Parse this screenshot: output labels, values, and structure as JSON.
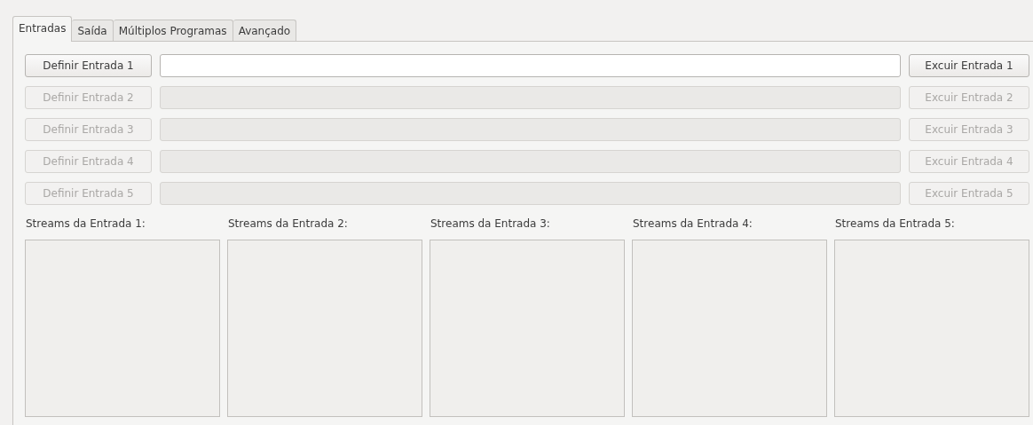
{
  "tabs": [
    {
      "label": "Entradas",
      "selected": true
    },
    {
      "label": "Saída",
      "selected": false
    },
    {
      "label": "Múltiplos Programas",
      "selected": false
    },
    {
      "label": "Avançado",
      "selected": false
    }
  ],
  "inputs": [
    {
      "define_button": "Definir Entrada 1",
      "remove_button": "Excuir Entrada 1",
      "disabled": false
    },
    {
      "define_button": "Definir Entrada 2",
      "remove_button": "Excuir Entrada 2",
      "disabled": true
    },
    {
      "define_button": "Definir Entrada 3",
      "remove_button": "Excuir Entrada 3",
      "disabled": true
    },
    {
      "define_button": "Definir Entrada 4",
      "remove_button": "Excuir Entrada 4",
      "disabled": true
    },
    {
      "define_button": "Definir Entrada 5",
      "remove_button": "Excuir Entrada 5",
      "disabled": true
    }
  ],
  "streams": [
    {
      "label": "Streams da Entrada 1:"
    },
    {
      "label": "Streams da Entrada 2:"
    },
    {
      "label": "Streams da Entrada 3:"
    },
    {
      "label": "Streams da Entrada 4:"
    },
    {
      "label": "Streams da Entrada 5:"
    }
  ]
}
